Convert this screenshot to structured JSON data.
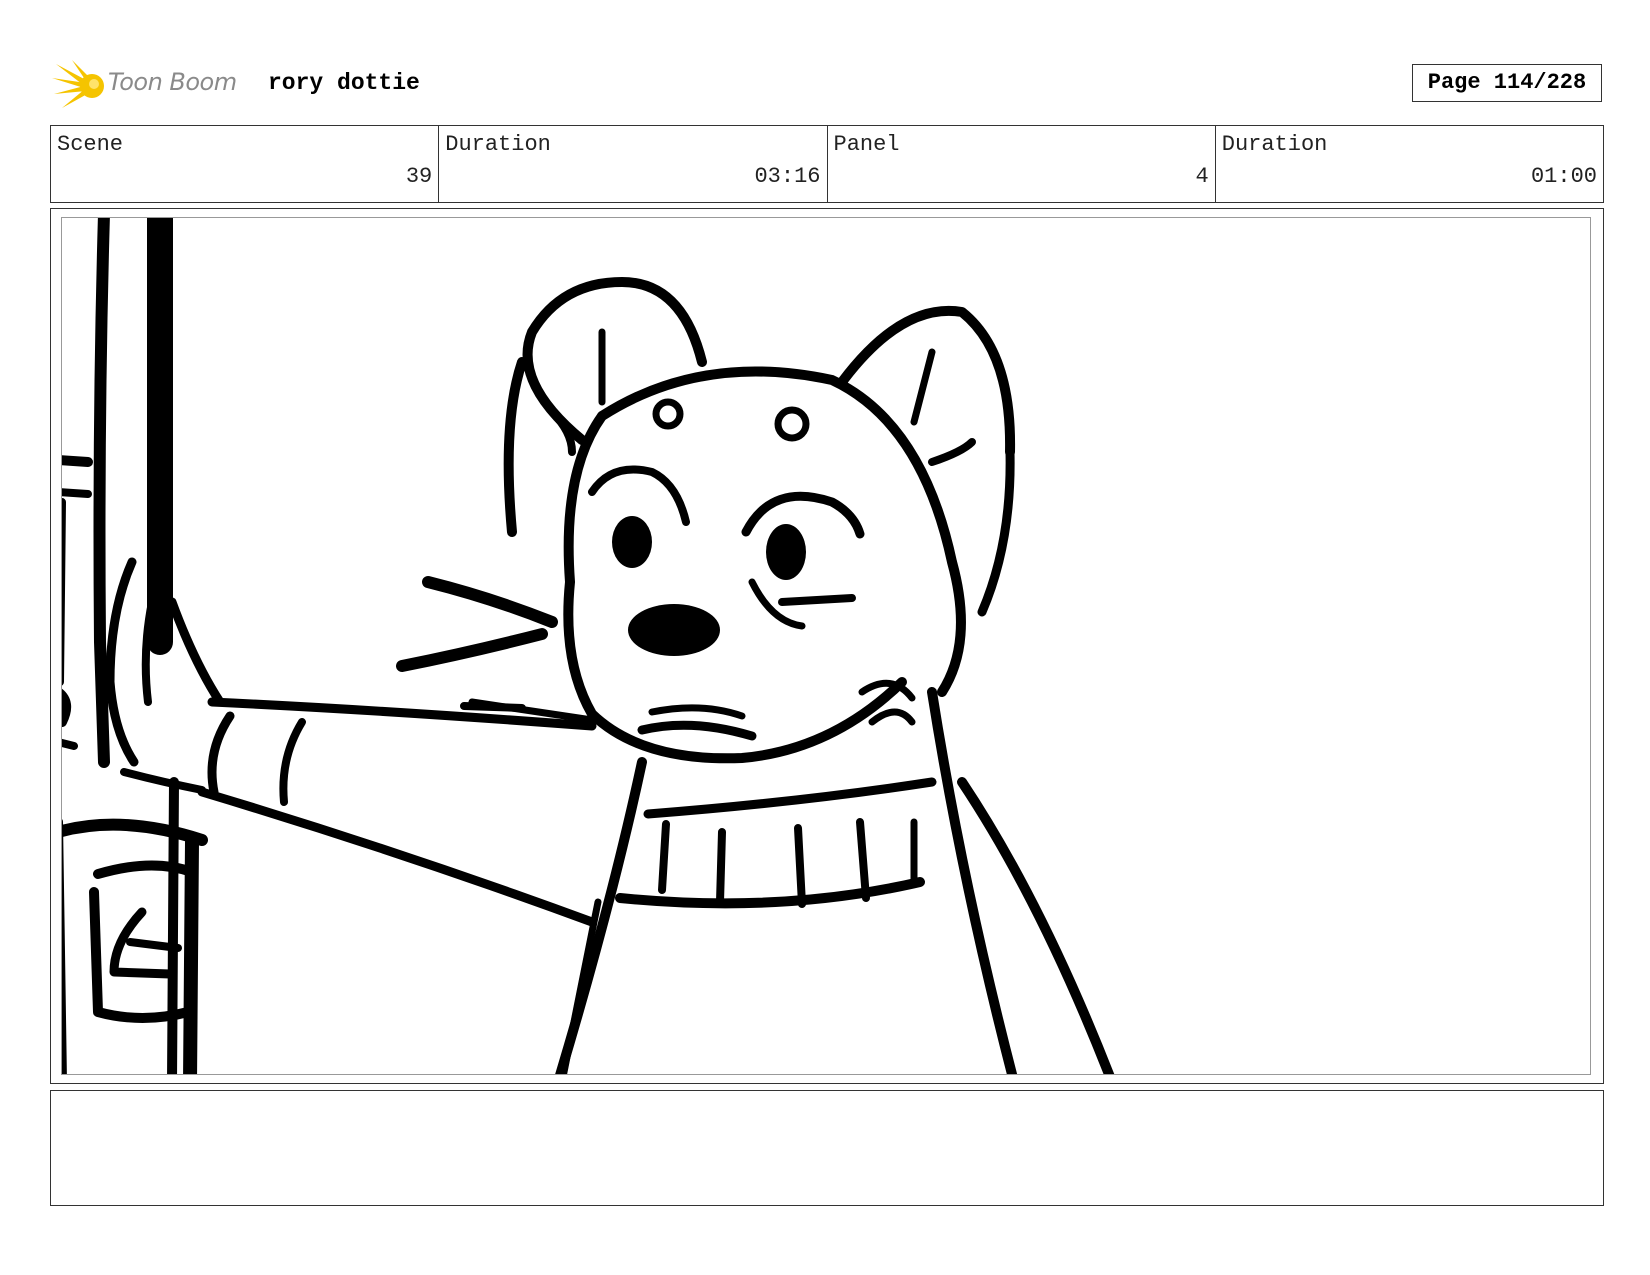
{
  "header": {
    "logo_text": "Toon Boom",
    "project_name": "rory dottie",
    "page_label": "Page 114/228"
  },
  "info": {
    "scene_label": "Scene",
    "scene_value": "39",
    "scene_duration_label": "Duration",
    "scene_duration_value": "03:16",
    "panel_label": "Panel",
    "panel_value": "4",
    "panel_duration_label": "Duration",
    "panel_duration_value": "01:00"
  },
  "colors": {
    "logo_accent": "#f5c400",
    "logo_text": "#8a8a8a",
    "ink": "#000000"
  },
  "notes": {
    "text": ""
  }
}
